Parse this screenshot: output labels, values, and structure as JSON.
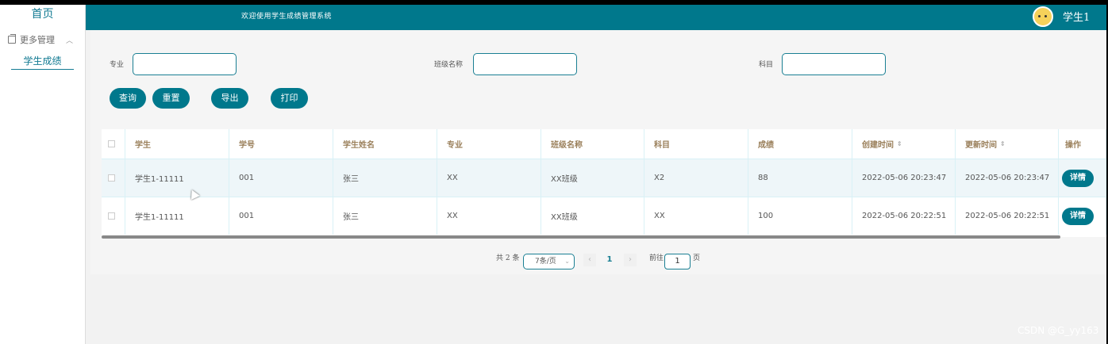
{
  "sidebar": {
    "home": "首页",
    "group": "更多管理",
    "item": "学生成绩"
  },
  "header": {
    "title": "欢迎使用学生成绩管理系统",
    "user": "学生1"
  },
  "filters": {
    "major_label": "专业",
    "class_label": "班级名称",
    "subject_label": "科目"
  },
  "buttons": {
    "query": "查询",
    "reset": "重置",
    "export": "导出",
    "print": "打印"
  },
  "table": {
    "headers": [
      "学生",
      "学号",
      "学生姓名",
      "专业",
      "班级名称",
      "科目",
      "成绩",
      "创建时间",
      "更新时间",
      "操作"
    ],
    "sort_glyph": "⇕",
    "detail_label": "详情",
    "rows": [
      [
        "学生1-11111",
        "001",
        "张三",
        "XX",
        "XX班级",
        "X2",
        "88",
        "2022-05-06 20:23:47",
        "2022-05-06 20:23:47"
      ],
      [
        "学生1-11111",
        "001",
        "张三",
        "XX",
        "XX班级",
        "XX",
        "100",
        "2022-05-06 20:22:51",
        "2022-05-06 20:22:51"
      ]
    ]
  },
  "pagination": {
    "total": "共 2 条",
    "page_size": "7条/页",
    "prev": "‹",
    "current": "1",
    "next": "›",
    "goto_label": "前往",
    "goto_value": "1",
    "page_suffix": "页"
  },
  "watermark": "CSDN @G_yy163",
  "colors": {
    "primary": "#00788c",
    "accent": "#137b93"
  }
}
